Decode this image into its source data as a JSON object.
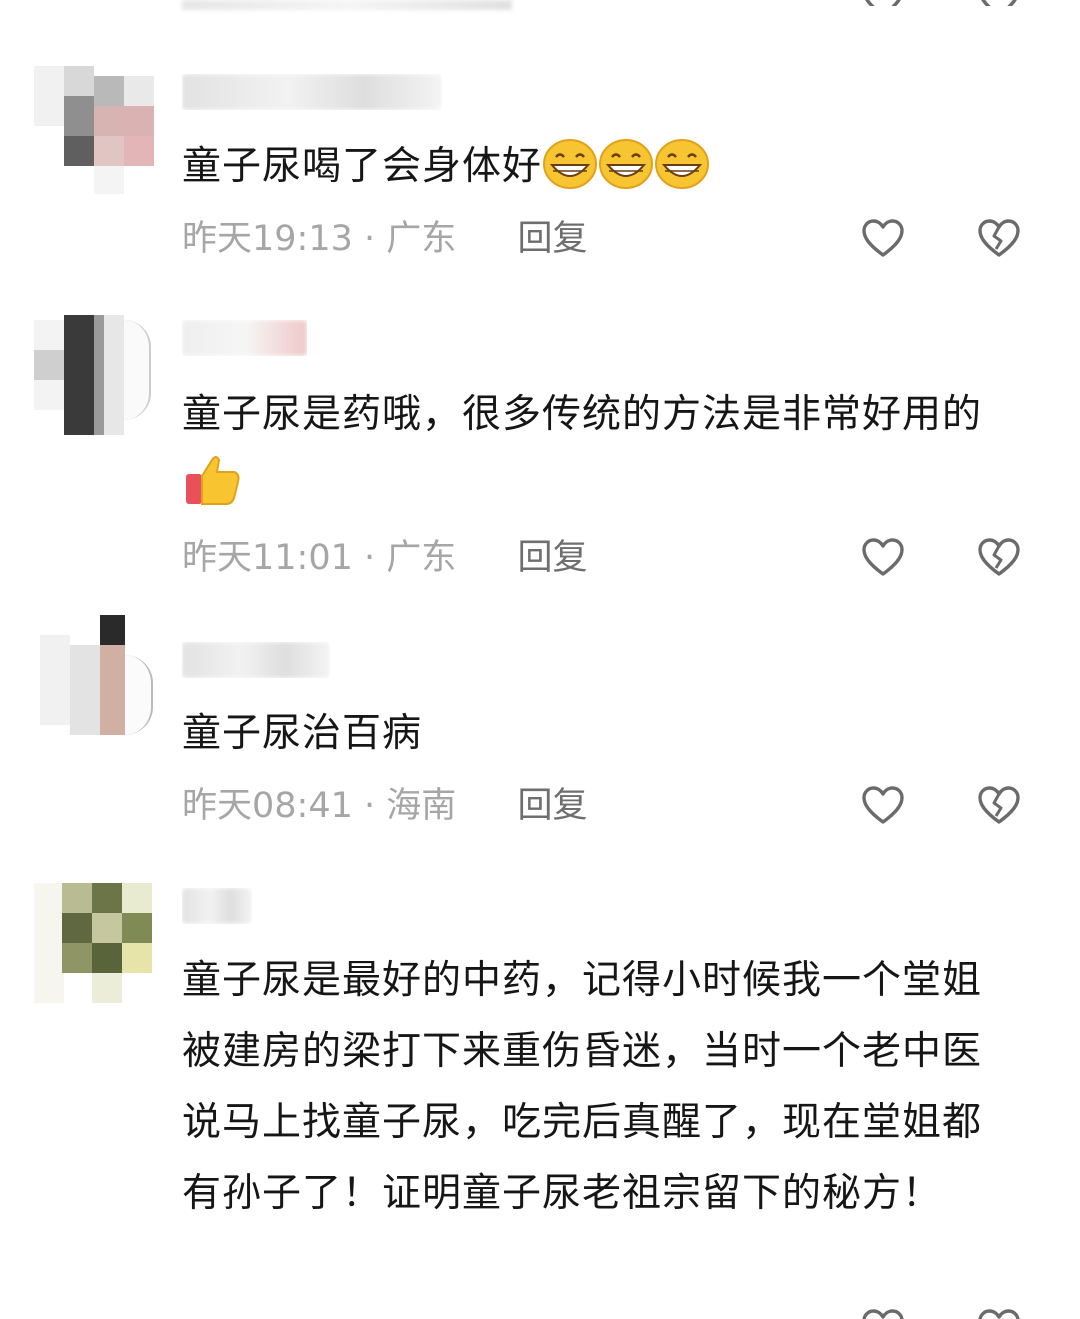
{
  "comments": [
    {
      "username": "",
      "text": "童子尿喝了会身体好",
      "emoji": [
        "grinning-face",
        "grinning-face",
        "grinning-face"
      ],
      "time": "昨天19:13",
      "location": "广东",
      "reply": "回复"
    },
    {
      "username": "",
      "text": "童子尿是药哦，很多传统的方法是非常好用的",
      "emoji": [
        "thumbs-up"
      ],
      "time": "昨天11:01",
      "location": "广东",
      "reply": "回复"
    },
    {
      "username": "",
      "text": "童子尿治百病",
      "emoji": [],
      "time": "昨天08:41",
      "location": "海南",
      "reply": "回复"
    },
    {
      "username": "",
      "text": "童子尿是最好的中药，记得小时候我一个堂姐被建房的梁打下来重伤昏迷，当时一个老中医说马上找童子尿，吃完后真醒了，现在堂姐都有孙子了！证明童子尿老祖宗留下的秘方！",
      "emoji": [],
      "time": "",
      "location": "",
      "reply": ""
    }
  ],
  "colors": {
    "text": "#161616",
    "meta": "#a6a6a6",
    "reply": "#6e6e6e",
    "icon": "#6b6b6b"
  },
  "icons": {
    "like": "heart-outline-icon",
    "dislike": "broken-heart-icon"
  }
}
